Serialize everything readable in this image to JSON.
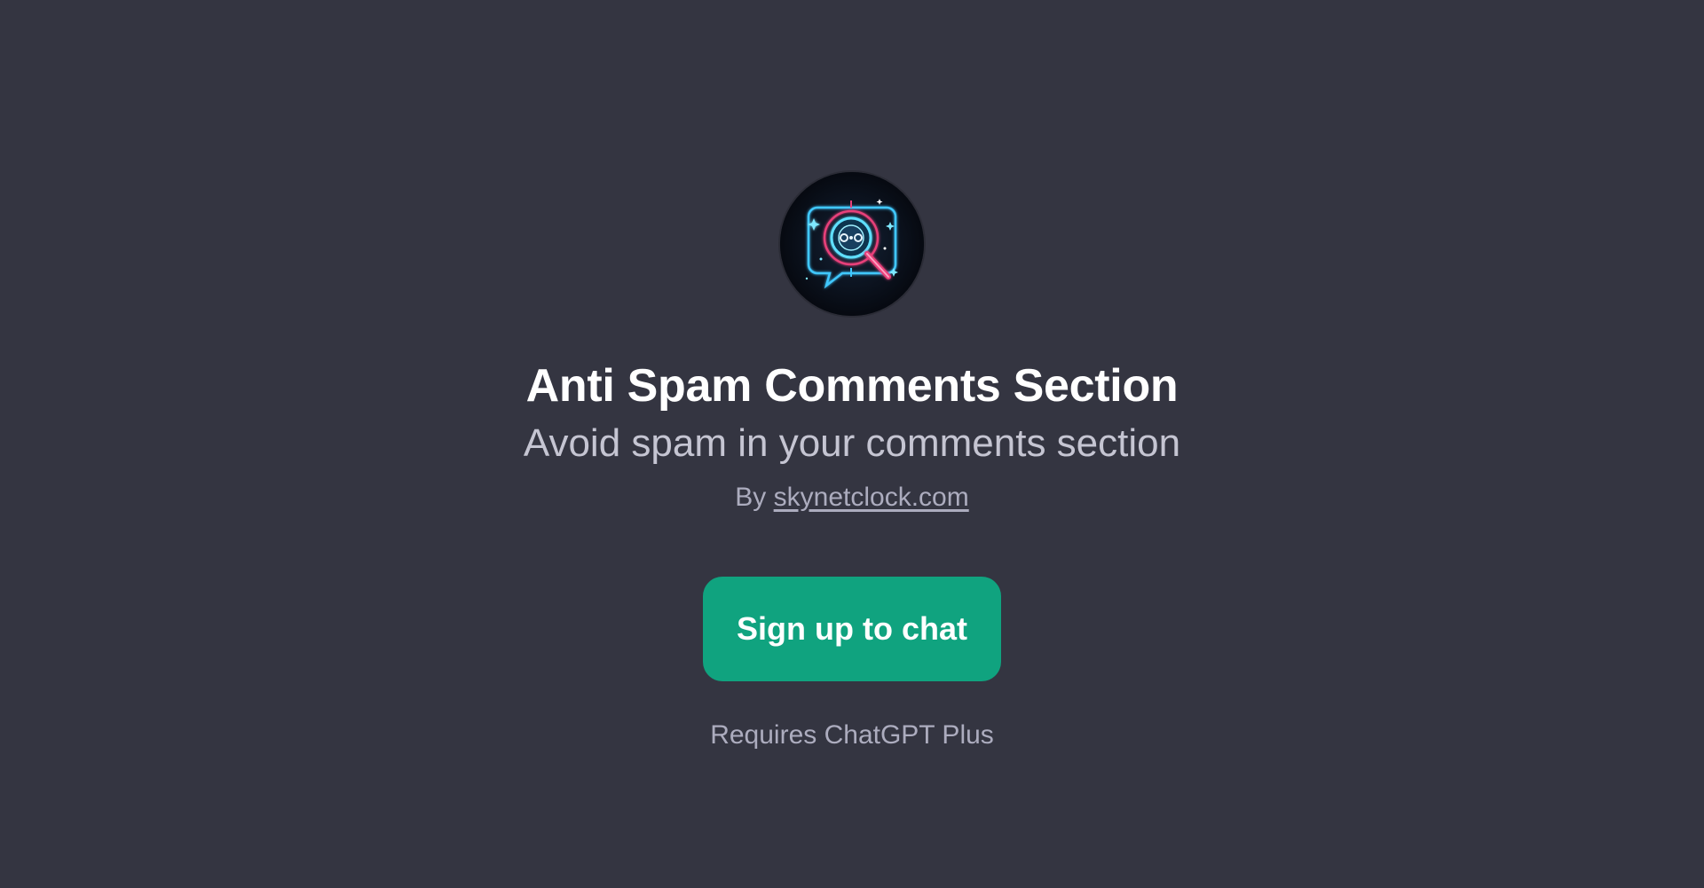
{
  "gpt": {
    "icon": "neon-chat-magnifier-icon",
    "title": "Anti Spam Comments Section",
    "subtitle": "Avoid spam in your comments section",
    "by_prefix": "By",
    "author": "skynetclock.com"
  },
  "cta": {
    "label": "Sign up to chat"
  },
  "footer": {
    "requires": "Requires ChatGPT Plus"
  },
  "colors": {
    "background": "#343541",
    "button": "#10a37f",
    "title": "#ffffff",
    "subtitle": "#c5c5d2",
    "muted": "#acacbe"
  }
}
